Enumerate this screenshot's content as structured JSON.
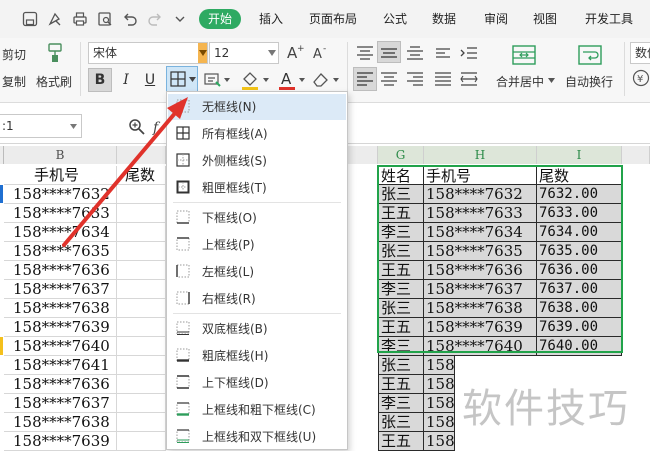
{
  "tabs": [
    "开始",
    "插入",
    "页面布局",
    "公式",
    "数据",
    "审阅",
    "视图",
    "开发工具"
  ],
  "ribbon": {
    "cut": "剪切",
    "copy": "复制",
    "format_painter": "格式刷",
    "font_name": "宋体",
    "font_size": "12",
    "bold": "B",
    "italic": "I",
    "underline": "U",
    "merge_center": "合并居中",
    "wrap_text": "自动换行",
    "number_group": "数值"
  },
  "namebox": ":1",
  "columns_left": {
    "b_letter": "B"
  },
  "columns_right": {
    "g_letter": "G",
    "h_letter": "H",
    "i_letter": "I"
  },
  "left_sheet": {
    "header_phone": "手机号",
    "header_tail": "尾数",
    "phones": [
      "158****7632",
      "158****7633",
      "158****7634",
      "158****7635",
      "158****7636",
      "158****7637",
      "158****7638",
      "158****7639",
      "158****7640",
      "158****7641",
      "158****7636",
      "158****7637",
      "158****7638",
      "158****7639"
    ]
  },
  "right_sheet": {
    "header_name": "姓名",
    "header_phone": "手机号",
    "header_tail": "尾数",
    "rows": [
      {
        "name": "张三",
        "phone": "158****7632",
        "tail": "7632.00"
      },
      {
        "name": "王五",
        "phone": "158****7633",
        "tail": "7633.00"
      },
      {
        "name": "李三",
        "phone": "158****7634",
        "tail": "7634.00"
      },
      {
        "name": "张三",
        "phone": "158****7635",
        "tail": "7635.00"
      },
      {
        "name": "王五",
        "phone": "158****7636",
        "tail": "7636.00"
      },
      {
        "name": "李三",
        "phone": "158****7637",
        "tail": "7637.00"
      },
      {
        "name": "张三",
        "phone": "158****7638",
        "tail": "7638.00"
      },
      {
        "name": "王五",
        "phone": "158****7639",
        "tail": "7639.00"
      },
      {
        "name": "李三",
        "phone": "158****7640",
        "tail": "7640.00"
      },
      {
        "name": "张三",
        "phone": "158",
        "tail": ""
      },
      {
        "name": "王五",
        "phone": "158",
        "tail": ""
      },
      {
        "name": "李三",
        "phone": "158",
        "tail": ""
      },
      {
        "name": "张三",
        "phone": "158",
        "tail": ""
      },
      {
        "name": "王五",
        "phone": "158",
        "tail": ""
      }
    ]
  },
  "border_menu": {
    "items": [
      {
        "label": "无框线(N)",
        "icon": "no-border-icon"
      },
      {
        "label": "所有框线(A)",
        "icon": "all-borders-icon"
      },
      {
        "label": "外侧框线(S)",
        "icon": "outside-borders-icon"
      },
      {
        "label": "粗匣框线(T)",
        "icon": "thick-box-border-icon"
      },
      {
        "label": "下框线(O)",
        "icon": "bottom-border-icon"
      },
      {
        "label": "上框线(P)",
        "icon": "top-border-icon"
      },
      {
        "label": "左框线(L)",
        "icon": "left-border-icon"
      },
      {
        "label": "右框线(R)",
        "icon": "right-border-icon"
      },
      {
        "label": "双底框线(B)",
        "icon": "double-bottom-border-icon"
      },
      {
        "label": "粗底框线(H)",
        "icon": "thick-bottom-border-icon"
      },
      {
        "label": "上下框线(D)",
        "icon": "top-bottom-border-icon"
      },
      {
        "label": "上框线和粗下框线(C)",
        "icon": "top-thick-bottom-border-icon"
      },
      {
        "label": "上框线和双下框线(U)",
        "icon": "top-double-bottom-border-icon"
      }
    ]
  },
  "watermark": "软件技巧",
  "colors": {
    "accent_green": "#2eaa62",
    "selection_green": "#21a34a",
    "arrow_red": "#e0322b",
    "cell_fill_gray": "#d9d9d9"
  }
}
